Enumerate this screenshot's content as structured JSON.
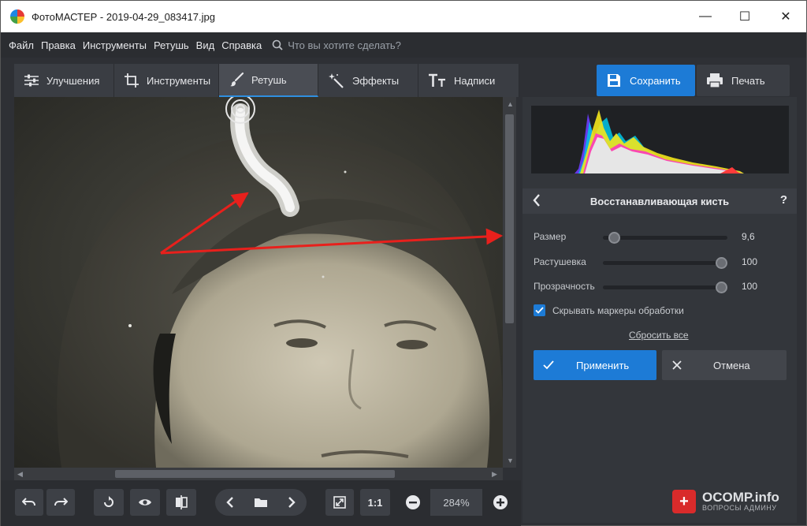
{
  "window": {
    "title": "ФотоМАСТЕР - 2019-04-29_083417.jpg",
    "minimize_glyph": "—",
    "maximize_glyph": "☐",
    "close_glyph": "✕"
  },
  "menu": {
    "items": [
      "Файл",
      "Правка",
      "Инструменты",
      "Ретушь",
      "Вид",
      "Справка"
    ],
    "search_placeholder": "Что вы хотите сделать?"
  },
  "tabs": [
    {
      "label": "Улучшения",
      "icon": "sliders-icon"
    },
    {
      "label": "Инструменты",
      "icon": "crop-icon"
    },
    {
      "label": "Ретушь",
      "icon": "brush-icon",
      "active": true
    },
    {
      "label": "Эффекты",
      "icon": "magic-wand-icon"
    },
    {
      "label": "Надписи",
      "icon": "text-icon"
    }
  ],
  "actions": {
    "save_label": "Сохранить",
    "print_label": "Печать"
  },
  "panel": {
    "title": "Восстанавливающая кисть",
    "help_glyph": "?",
    "sliders": [
      {
        "label": "Размер",
        "value": "9,6",
        "fraction": 0.05
      },
      {
        "label": "Растушевка",
        "value": "100",
        "fraction": 1.0
      },
      {
        "label": "Прозрачность",
        "value": "100",
        "fraction": 1.0
      }
    ],
    "hide_markers_label": "Скрывать маркеры обработки",
    "hide_markers_checked": true,
    "reset_label": "Сбросить все",
    "apply_label": "Применить",
    "cancel_label": "Отмена"
  },
  "toolbar": {
    "actual_size_label": "1:1",
    "zoom_value": "284%"
  },
  "watermark": {
    "main": "OCOMP.info",
    "sub": "ВОПРОСЫ АДМИНУ",
    "badge": "+"
  },
  "colors": {
    "accent": "#1d7bd6",
    "panel_bg": "#33363b",
    "annotation_arrow": "#e8201c"
  }
}
